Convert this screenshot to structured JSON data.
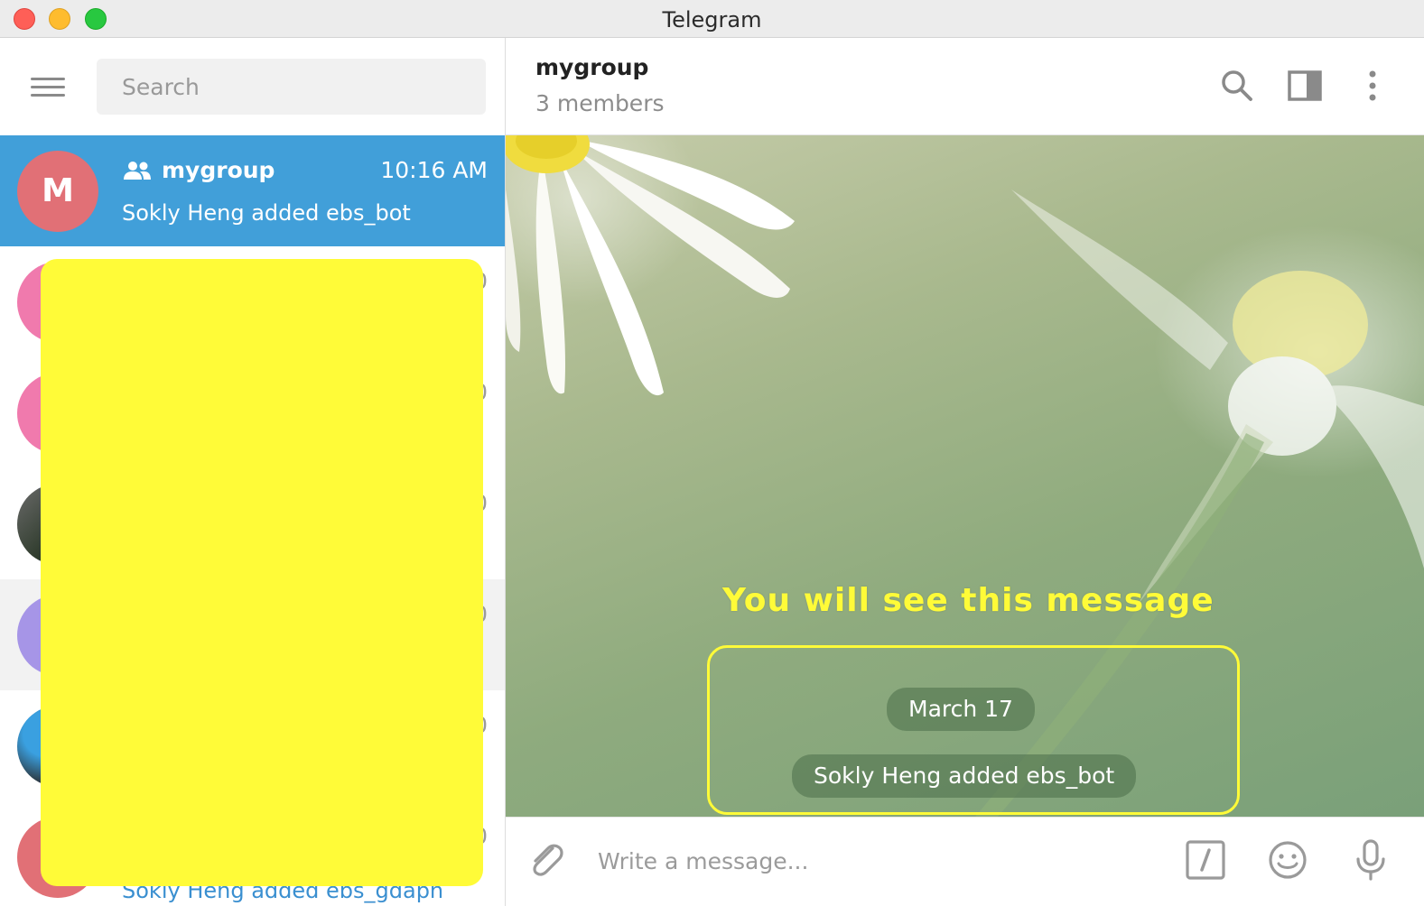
{
  "window": {
    "title": "Telegram"
  },
  "sidebar": {
    "search_placeholder": "Search",
    "active_chat": {
      "avatar_letter": "M",
      "avatar_color": "#e17076",
      "name": "mygroup",
      "time": "10:16 AM",
      "preview": "Sokly Heng added ebs_bot"
    },
    "other_rows": [
      {
        "avatar_color": "#f07aad",
        "time": "0"
      },
      {
        "avatar_color": "#f07aad",
        "time": "0"
      },
      {
        "avatar_color": "photo",
        "time": "0"
      },
      {
        "avatar_color": "#a695e7",
        "time": "0"
      },
      {
        "avatar_color": "photo",
        "time": "0"
      },
      {
        "avatar_color": "#e17076",
        "time": "0",
        "preview": "Sokly Heng added ebs_gdaph"
      }
    ]
  },
  "chat": {
    "title": "mygroup",
    "subtitle": "3 members",
    "annotation": "You will see this message",
    "date_label": "March 17",
    "service_message": "Sokly Heng added ebs_bot"
  },
  "composer": {
    "placeholder": "Write a message..."
  },
  "colors": {
    "accent": "#419fd9",
    "annotation_yellow": "#fffb38"
  }
}
